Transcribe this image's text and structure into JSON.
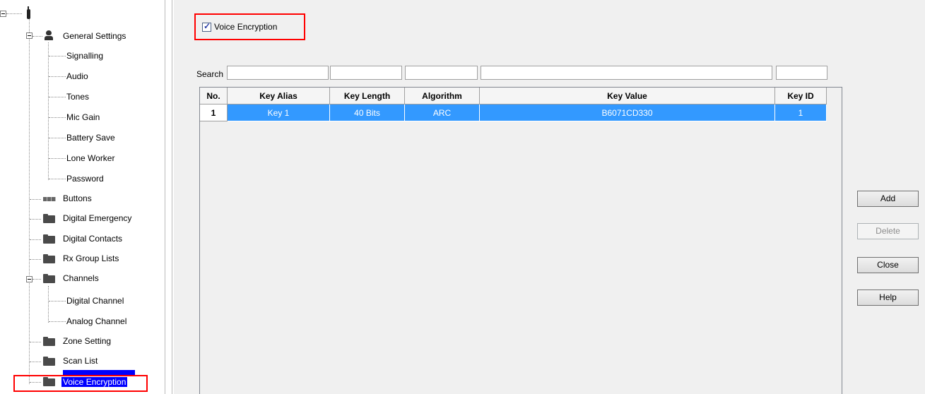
{
  "tree": {
    "root_icon": "radio-icon",
    "items": [
      {
        "label": "General Settings",
        "icon": "person-icon"
      },
      {
        "label": "Signalling"
      },
      {
        "label": "Audio"
      },
      {
        "label": "Tones"
      },
      {
        "label": "Mic Gain"
      },
      {
        "label": "Battery Save"
      },
      {
        "label": "Lone Worker"
      },
      {
        "label": "Password"
      },
      {
        "label": "Buttons",
        "icon": "buttons-icon"
      },
      {
        "label": "Digital Emergency",
        "icon": "folder-icon"
      },
      {
        "label": "Digital Contacts",
        "icon": "folder-icon"
      },
      {
        "label": "Rx Group Lists",
        "icon": "folder-icon"
      },
      {
        "label": "Channels",
        "icon": "folder-icon"
      },
      {
        "label": "Digital Channel"
      },
      {
        "label": "Analog Channel"
      },
      {
        "label": "Zone Setting",
        "icon": "folder-icon"
      },
      {
        "label": "Scan List",
        "icon": "folder-icon"
      },
      {
        "label": "Voice Encryption",
        "icon": "folder-icon",
        "selected": true
      }
    ]
  },
  "panel": {
    "voice_encryption": {
      "label": "Voice Encryption",
      "checked": true
    },
    "search": {
      "label": "Search",
      "values": [
        "",
        "",
        "",
        "",
        ""
      ]
    },
    "table": {
      "columns": [
        "No.",
        "Key Alias",
        "Key Length",
        "Algorithm",
        "Key Value",
        "Key ID"
      ],
      "rows": [
        {
          "no": "1",
          "alias": "Key 1",
          "length": "40 Bits",
          "algorithm": "ARC",
          "value": "B6071CD330",
          "id": "1",
          "selected": true
        }
      ]
    },
    "buttons": {
      "add": "Add",
      "delete": "Delete",
      "close": "Close",
      "help": "Help"
    }
  },
  "colors": {
    "selection": "#3399ff",
    "tree_selection": "#0000ff",
    "highlight_box": "#ff0000"
  }
}
